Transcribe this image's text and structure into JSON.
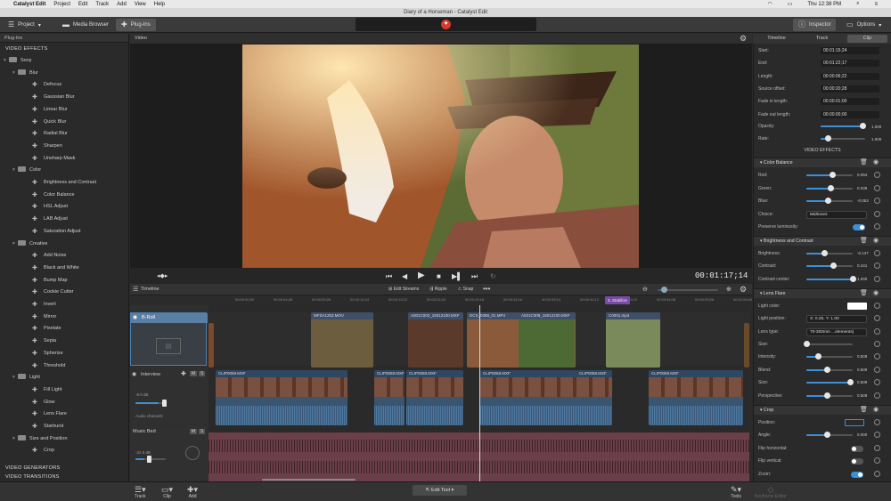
{
  "menubar": {
    "apple": "",
    "app": "Catalyst Edit",
    "items": [
      "Project",
      "Edit",
      "Track",
      "Add",
      "View",
      "Help"
    ],
    "clock": "Thu 12:38 PM"
  },
  "window": {
    "title": "Diary of a Horseman - Catalyst Edit"
  },
  "toolbar": {
    "project": "Project",
    "media_browser": "Media Browser",
    "plugins": "Plug-Ins",
    "inspector": "Inspector",
    "options": "Options"
  },
  "left_panel": {
    "header": "Plug-Ins",
    "video_effects": "VIDEO EFFECTS",
    "video_generators": "VIDEO GENERATORS",
    "video_transitions": "VIDEO TRANSITIONS",
    "tree": [
      {
        "label": "Sony",
        "level": 0,
        "type": "folder"
      },
      {
        "label": "Blur",
        "level": 1,
        "type": "folder"
      },
      {
        "label": "Defocus",
        "level": 2,
        "type": "plugin"
      },
      {
        "label": "Gaussian Blur",
        "level": 2,
        "type": "plugin"
      },
      {
        "label": "Linear Blur",
        "level": 2,
        "type": "plugin"
      },
      {
        "label": "Quick Blur",
        "level": 2,
        "type": "plugin"
      },
      {
        "label": "Radial Blur",
        "level": 2,
        "type": "plugin"
      },
      {
        "label": "Sharpen",
        "level": 2,
        "type": "plugin"
      },
      {
        "label": "Unsharp Mask",
        "level": 2,
        "type": "plugin"
      },
      {
        "label": "Color",
        "level": 1,
        "type": "folder"
      },
      {
        "label": "Brightness and Contrast",
        "level": 2,
        "type": "plugin"
      },
      {
        "label": "Color Balance",
        "level": 2,
        "type": "plugin"
      },
      {
        "label": "HSL Adjust",
        "level": 2,
        "type": "plugin"
      },
      {
        "label": "LAB Adjust",
        "level": 2,
        "type": "plugin"
      },
      {
        "label": "Saturation Adjust",
        "level": 2,
        "type": "plugin"
      },
      {
        "label": "Creative",
        "level": 1,
        "type": "folder"
      },
      {
        "label": "Add Noise",
        "level": 2,
        "type": "plugin"
      },
      {
        "label": "Black and White",
        "level": 2,
        "type": "plugin"
      },
      {
        "label": "Bump Map",
        "level": 2,
        "type": "plugin"
      },
      {
        "label": "Cookie Cutter",
        "level": 2,
        "type": "plugin"
      },
      {
        "label": "Invert",
        "level": 2,
        "type": "plugin"
      },
      {
        "label": "Mirror",
        "level": 2,
        "type": "plugin"
      },
      {
        "label": "Pixelate",
        "level": 2,
        "type": "plugin"
      },
      {
        "label": "Sepia",
        "level": 2,
        "type": "plugin"
      },
      {
        "label": "Spherize",
        "level": 2,
        "type": "plugin"
      },
      {
        "label": "Threshold",
        "level": 2,
        "type": "plugin"
      },
      {
        "label": "Light",
        "level": 1,
        "type": "folder"
      },
      {
        "label": "Fill Light",
        "level": 2,
        "type": "plugin"
      },
      {
        "label": "Glow",
        "level": 2,
        "type": "plugin"
      },
      {
        "label": "Lens Flare",
        "level": 2,
        "type": "plugin"
      },
      {
        "label": "Starburst",
        "level": 2,
        "type": "plugin"
      },
      {
        "label": "Size and Position",
        "level": 1,
        "type": "folder"
      },
      {
        "label": "Crop",
        "level": 2,
        "type": "plugin"
      }
    ]
  },
  "viewer": {
    "header": "Video",
    "timecode": "00:01:17;14"
  },
  "timeline": {
    "label": "Timeline",
    "edit_streams": "Edit Streams",
    "ripple": "Ripple",
    "snap": "Snap",
    "ruler_ticks": [
      "00:00:00;00",
      "00:00:04;28",
      "00:00:09;26",
      "00:00:14;24",
      "00:00:19;22",
      "00:00:24;20",
      "00:00:29;18",
      "00:00:34;16",
      "00:00:39;14",
      "00:00:44;12",
      "00:00:49;10",
      "00:00:54;08",
      "00:00:59;06",
      "00:01:04;04",
      "00:01:09;02"
    ],
    "marker": "3. Stabilize",
    "tracks": {
      "broll": "B-Roll",
      "interview": "Interview",
      "music": "Music Bed",
      "interview_level": "-8.0 dB",
      "music_level": "-22.9 dB",
      "audio_channels": "Audio channels",
      "m": "M",
      "s": "S"
    },
    "broll_clips": [
      "MFSA1253.MOV",
      "A001C002_15012100.MXF",
      "DCS_0368_01.MP4",
      "A021C008_15012100.MXF",
      "C0001.mp4"
    ],
    "interview_clips": [
      "CLIP0059.MXF",
      "CLIP0059.MXF",
      "CLIP0058.MXF",
      "CLIP0058.MXF",
      "CLIP0058.MXF",
      "CLIP0059.MXF"
    ]
  },
  "bottombar": {
    "track": "Track",
    "clip": "Clip",
    "add": "Add",
    "edit_tool": "Edit Tool",
    "tools": "Tools",
    "keyframe": "Keyframe Editor"
  },
  "inspector": {
    "tabs": [
      "Timeline",
      "Track",
      "Clip"
    ],
    "fields": [
      {
        "label": "Start:",
        "value": "00:01:15;24"
      },
      {
        "label": "End:",
        "value": "00:01:22;17"
      },
      {
        "label": "Length:",
        "value": "00:00:06;22"
      },
      {
        "label": "Source offset:",
        "value": "00:00:20;28"
      },
      {
        "label": "Fade in length:",
        "value": "00:00:01;00"
      },
      {
        "label": "Fade out length:",
        "value": "00:00:00;00"
      }
    ],
    "opacity": {
      "label": "Opacity:",
      "value": "1.000"
    },
    "rate": {
      "label": "Rate:",
      "value": "1.000"
    },
    "video_effects": "VIDEO EFFECTS",
    "color_balance": {
      "title": "Color Balance",
      "red": {
        "label": "Red:",
        "value": "0.094"
      },
      "green": {
        "label": "Green:",
        "value": "0.039"
      },
      "blue": {
        "label": "Blue:",
        "value": "-0.053"
      },
      "choice": {
        "label": "Choice:",
        "value": "Midtones"
      },
      "preserve": {
        "label": "Preserve luminosity:"
      }
    },
    "brightness": {
      "title": "Brightness and Contrast",
      "brightness": {
        "label": "Brightness:",
        "value": "-0.137"
      },
      "contrast": {
        "label": "Contrast:",
        "value": "0.241"
      },
      "contrast_center": {
        "label": "Contrast center:",
        "value": "1.000"
      }
    },
    "lens_flare": {
      "title": "Lens Flare",
      "light_color": {
        "label": "Light color:"
      },
      "light_position": {
        "label": "Light position:",
        "value": "X: 0.25, Y: 1.00"
      },
      "lens_type": {
        "label": "Lens type:",
        "value": "70-300mm ...elements)"
      },
      "size": {
        "label": "Size:",
        "value": ""
      },
      "intensity": {
        "label": "Intensity:",
        "value": "0.509"
      },
      "blend": {
        "label": "Blend:",
        "value": "0.509"
      },
      "size2": {
        "label": "Size:",
        "value": "0.509"
      },
      "perspective": {
        "label": "Perspective:",
        "value": "0.509"
      }
    },
    "crop": {
      "title": "Crop",
      "position": {
        "label": "Position:"
      },
      "angle": {
        "label": "Angle:",
        "value": "0.000"
      },
      "flip_h": {
        "label": "Flip horizontal:"
      },
      "flip_v": {
        "label": "Flip vertical:"
      },
      "zoom": {
        "label": "Zoom:"
      }
    }
  },
  "colors": {
    "accent": "#3d8fd6",
    "brand": "#d63a2f",
    "music_track": "#6b3f49",
    "video_clip": "#3f4f66"
  }
}
